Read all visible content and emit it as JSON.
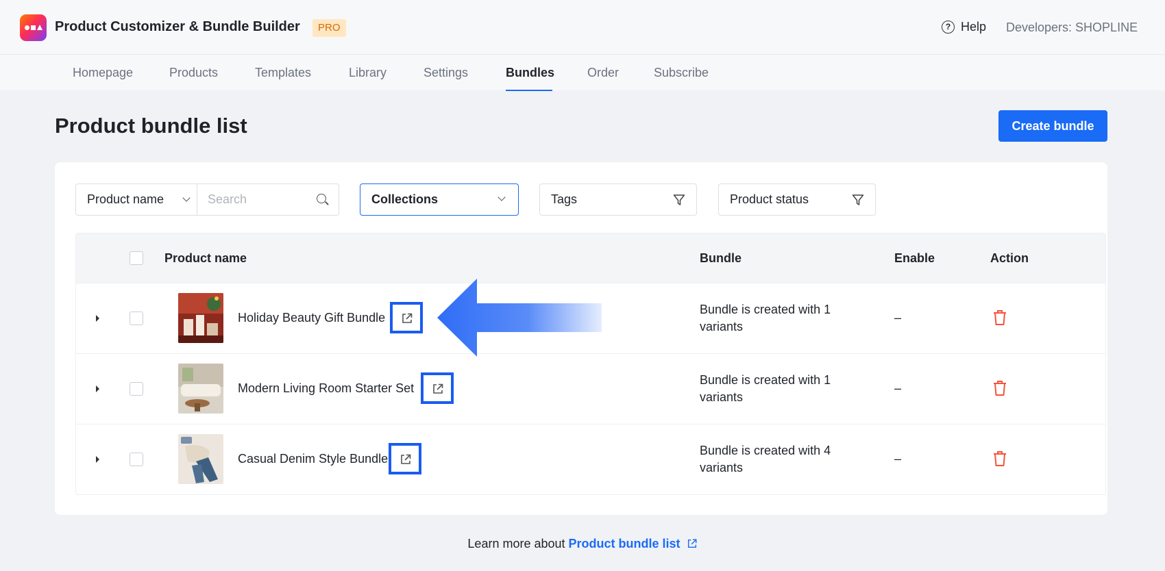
{
  "header": {
    "app_title": "Product Customizer & Bundle Builder",
    "badge": "PRO",
    "help_label": "Help",
    "developers_label": "Developers: SHOPLINE"
  },
  "nav": {
    "items": [
      "Homepage",
      "Products",
      "Templates",
      "Library",
      "Settings",
      "Bundles",
      "Order",
      "Subscribe"
    ],
    "active": "Bundles"
  },
  "page": {
    "title": "Product bundle list",
    "create_button": "Create bundle"
  },
  "filters": {
    "field_select": "Product name",
    "search_placeholder": "Search",
    "collections": "Collections",
    "tags": "Tags",
    "product_status": "Product status"
  },
  "table": {
    "columns": [
      "Product name",
      "Bundle",
      "Enable",
      "Action"
    ],
    "rows": [
      {
        "name": "Holiday Beauty Gift Bundle",
        "bundle": "Bundle is created with 1 variants",
        "enable": "–"
      },
      {
        "name": "Modern Living Room Starter Set",
        "bundle": "Bundle is created with 1 variants",
        "enable": "–"
      },
      {
        "name": "Casual Denim Style Bundle",
        "bundle": "Bundle is created with 4 variants",
        "enable": "–"
      }
    ]
  },
  "footer": {
    "prefix": "Learn more about",
    "link": "Product bundle list"
  },
  "colors": {
    "accent": "#1a6bf5",
    "highlight_border": "#1a5cf0",
    "delete": "#f5533d",
    "badge_bg": "#ffe7c2",
    "badge_text": "#d46b08"
  },
  "icons": [
    "logo-icon",
    "help-icon",
    "chevron-down-icon",
    "search-icon",
    "filter-icon",
    "external-link-icon",
    "trash-icon",
    "expand-caret-icon",
    "arrow-annotation-icon"
  ]
}
